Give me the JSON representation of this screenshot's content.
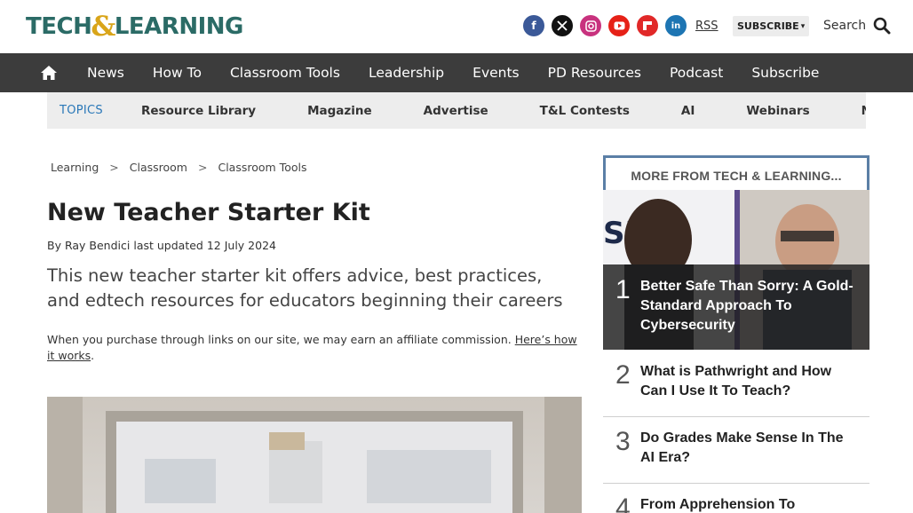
{
  "header": {
    "logo_left": "TECH",
    "logo_amp": "&",
    "logo_right": "LEARNING",
    "social_icons": [
      "facebook-icon",
      "x-icon",
      "instagram-icon",
      "youtube-icon",
      "flipboard-icon",
      "linkedin-icon"
    ],
    "rss_label": "RSS",
    "subscribe_label": "SUBSCRIBE",
    "search_label": "Search"
  },
  "nav": {
    "items": [
      "News",
      "How To",
      "Classroom Tools",
      "Leadership",
      "Events",
      "PD Resources",
      "Podcast",
      "Subscribe"
    ]
  },
  "topics": {
    "label": "TOPICS",
    "items": [
      "Resource Library",
      "Magazine",
      "Advertise",
      "T&L Contests",
      "AI",
      "Webinars",
      "News Sig"
    ]
  },
  "breadcrumb": [
    "Learning",
    "Classroom",
    "Classroom Tools"
  ],
  "breadcrumb_separator": ">",
  "article": {
    "title": "New Teacher Starter Kit",
    "byline_prefix": "By",
    "author": "Ray Bendici",
    "byline_mid": "last updated",
    "updated": "12 July 2024",
    "standfirst": "This new teacher starter kit offers advice, best practices, and edtech resources for educators beginning their careers",
    "affiliate_text": "When you purchase through links on our site, we may earn an affiliate commission.",
    "affiliate_link": "Here’s how it works"
  },
  "sidebar": {
    "title": "MORE FROM TECH & LEARNING...",
    "items": [
      {
        "num": "1",
        "text": "Better Safe Than Sorry: A Gold-Standard Approach To Cybersecurity"
      },
      {
        "num": "2",
        "text": "What is Pathwright and How Can I Use It To Teach?"
      },
      {
        "num": "3",
        "text": "Do Grades Make Sense In The AI Era?"
      },
      {
        "num": "4",
        "text": "From Apprehension To"
      }
    ]
  },
  "colors": {
    "brand_teal": "#2b6b66",
    "brand_gold": "#d9a51a",
    "nav_bg": "#3c3c3c",
    "topics_accent": "#2a78b8",
    "sidebar_border": "#5b7fa6"
  }
}
